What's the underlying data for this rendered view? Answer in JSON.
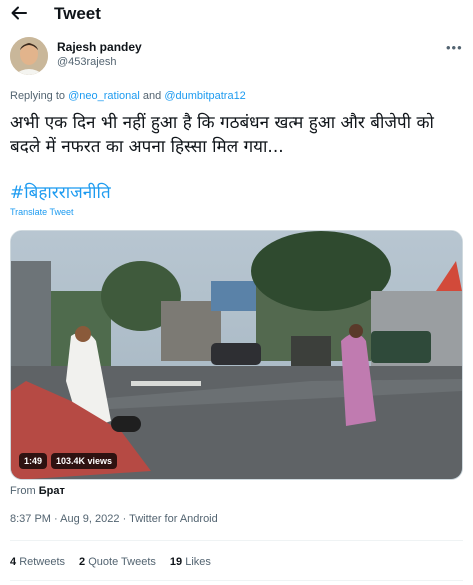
{
  "header": {
    "title": "Tweet"
  },
  "author": {
    "name": "Rajesh pandey",
    "handle": "@453rajesh"
  },
  "reply": {
    "prefix": "Replying to",
    "user1": "@neo_rational",
    "connector": "and",
    "user2": "@dumbitpatra12"
  },
  "tweet": {
    "text": "अभी एक दिन भी नहीं हुआ है कि गठबंधन खत्म हुआ और बीजेपी को बदले में नफरत का अपना हिस्सा मिल गया...",
    "hashtag": "#बिहारराजनीति",
    "translate": "Translate Tweet"
  },
  "video": {
    "duration": "1:49",
    "views": "103.4K views"
  },
  "from": {
    "label": "From",
    "source": "Брат"
  },
  "meta": {
    "time": "8:37 PM",
    "date": "Aug 9, 2022",
    "client": "Twitter for Android",
    "separator": "·"
  },
  "stats": {
    "retweets_count": "4",
    "retweets_label": "Retweets",
    "quotes_count": "2",
    "quotes_label": "Quote Tweets",
    "likes_count": "19",
    "likes_label": "Likes"
  },
  "icons": {
    "back": "arrow-left-icon",
    "more": "more-horizontal-icon"
  },
  "colors": {
    "accent": "#1d9bf0",
    "text": "#0f1419",
    "secondary": "#536471"
  }
}
